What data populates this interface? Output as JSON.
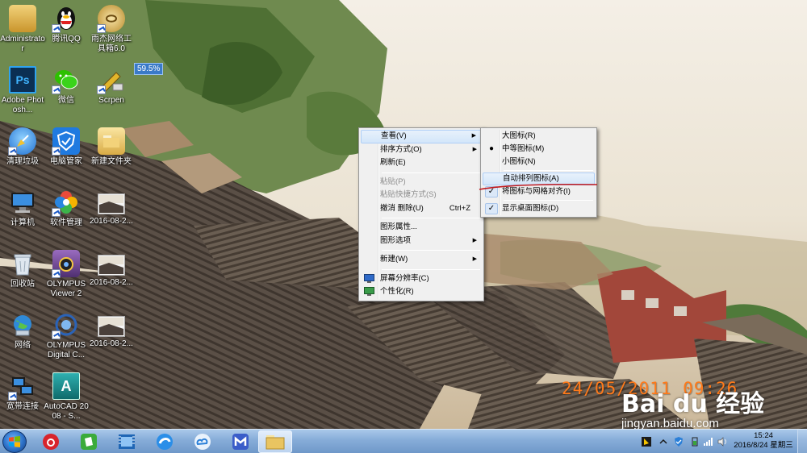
{
  "desktop": {
    "icons": [
      {
        "label": "Administrator",
        "icon": "user-folder-icon",
        "color": "#d9a637"
      },
      {
        "label": "腾讯QQ",
        "icon": "qq-penguin-icon",
        "color": "#111111"
      },
      {
        "label": "雨杰网络工具箱6.0",
        "icon": "network-toolbox-icon",
        "color": "#c89a3a"
      },
      {
        "label": "Adobe Photosh...",
        "icon": "photoshop-icon",
        "color": "#0b2f53",
        "text": "Ps"
      },
      {
        "label": "微信",
        "icon": "wechat-icon",
        "color": "#2dc100"
      },
      {
        "label": "Scrpen",
        "icon": "screen-pen-icon",
        "color": "#d7a21f"
      },
      {
        "label": "清理垃圾",
        "icon": "cleanup-broom-icon",
        "color": "#3b8ee0"
      },
      {
        "label": "电脑管家",
        "icon": "pc-manager-shield-icon",
        "color": "#1f7ae0"
      },
      {
        "label": "新建文件夹",
        "icon": "folder-icon",
        "color": "#e8c566"
      },
      {
        "label": "计算机",
        "icon": "computer-icon",
        "color": "#5a8fd0"
      },
      {
        "label": "软件管理",
        "icon": "software-manager-icon",
        "color": "#e84a3a"
      },
      {
        "label": "2016-08-2...",
        "icon": "image-thumbnail-icon",
        "color": "#f4f4f4"
      },
      {
        "label": "回收站",
        "icon": "recycle-bin-icon",
        "color": "#cfd8e2"
      },
      {
        "label": "OLYMPUS Viewer 2",
        "icon": "olympus-viewer-icon",
        "color": "#7a4b9a"
      },
      {
        "label": "2016-08-2...",
        "icon": "image-thumbnail-icon",
        "color": "#f4f4f4"
      },
      {
        "label": "网络",
        "icon": "network-globe-icon",
        "color": "#2f8ad8"
      },
      {
        "label": "OLYMPUS Digital C...",
        "icon": "olympus-digital-icon",
        "color": "#2a63b8"
      },
      {
        "label": "2016-08-2...",
        "icon": "image-thumbnail-icon",
        "color": "#f4f4f4"
      },
      {
        "label": "宽带连接",
        "icon": "broadband-connection-icon",
        "color": "#4a78b8"
      },
      {
        "label": "AutoCAD 2008 - S...",
        "icon": "autocad-icon",
        "color": "#1d8a8a",
        "text": "A"
      }
    ],
    "percent_badge": "59.5%"
  },
  "context_menu": {
    "items": [
      {
        "label": "查看(V)",
        "submenu": true,
        "state": "hover"
      },
      {
        "label": "排序方式(O)",
        "submenu": true
      },
      {
        "label": "刷新(E)"
      },
      {
        "separator": true
      },
      {
        "label": "粘贴(P)",
        "disabled": true
      },
      {
        "label": "粘贴快捷方式(S)",
        "disabled": true
      },
      {
        "label": "撤消 删除(U)",
        "shortcut": "Ctrl+Z"
      },
      {
        "separator": true
      },
      {
        "label": "图形属性..."
      },
      {
        "label": "图形选项",
        "submenu": true
      },
      {
        "separator": true
      },
      {
        "label": "新建(W)",
        "submenu": true
      },
      {
        "separator": true
      },
      {
        "label": "屏幕分辨率(C)",
        "icon": "display-resolution-icon"
      },
      {
        "label": "个性化(R)",
        "icon": "personalize-icon"
      }
    ]
  },
  "view_submenu": {
    "items": [
      {
        "label": "大图标(R)"
      },
      {
        "label": "中等图标(M)",
        "mark": "radio"
      },
      {
        "label": "小图标(N)"
      },
      {
        "separator": true
      },
      {
        "label": "自动排列图标(A)",
        "state": "hover"
      },
      {
        "label": "将图标与网格对齐(I)",
        "mark": "check"
      },
      {
        "separator": true
      },
      {
        "label": "显示桌面图标(D)",
        "mark": "check"
      }
    ],
    "annotation_color": "#c0191e"
  },
  "watermark": {
    "date_stamp": "24/05/2011 09:26",
    "logo": "Bai du 经验",
    "url": "jingyan.baidu.com"
  },
  "taskbar": {
    "pinned": [
      {
        "name": "netease-music-icon",
        "color": "#d8242c"
      },
      {
        "name": "evernote-icon",
        "color": "#3bab3b"
      },
      {
        "name": "video-player-icon",
        "color": "#1f66b5"
      },
      {
        "name": "browser-icon",
        "color": "#2a8ee8"
      },
      {
        "name": "cloud-drive-icon",
        "color": "#2a7fd8"
      },
      {
        "name": "maxthon-icon",
        "color": "#3a5dc9"
      },
      {
        "name": "explorer-folder-icon",
        "color": "#e9c461",
        "active": true
      }
    ],
    "clock_time": "15:24",
    "clock_date": "2016/8/24 星期三"
  }
}
